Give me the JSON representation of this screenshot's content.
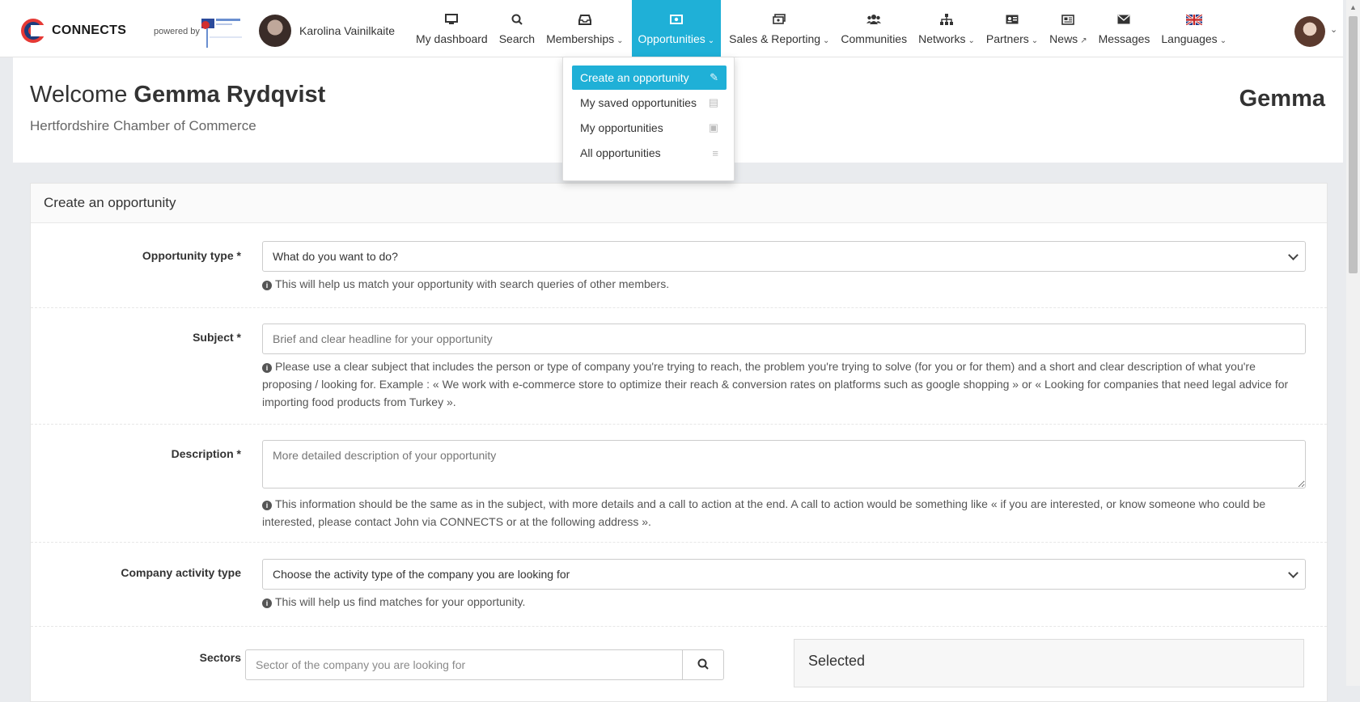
{
  "header": {
    "brand": "CONNECTS",
    "powered_by": "powered by",
    "user_name": "Karolina Vainilkaite",
    "nav": [
      {
        "label": "My dashboard",
        "icon": "monitor-icon",
        "has_chevron": false
      },
      {
        "label": "Search",
        "icon": "search-icon",
        "has_chevron": false
      },
      {
        "label": "Memberships",
        "icon": "inbox-icon",
        "has_chevron": true
      },
      {
        "label": "Opportunities",
        "icon": "money-icon",
        "has_chevron": true,
        "active": true
      },
      {
        "label": "Sales & Reporting",
        "icon": "money-stack-icon",
        "has_chevron": true
      },
      {
        "label": "Communities",
        "icon": "users-icon",
        "has_chevron": false
      },
      {
        "label": "Networks",
        "icon": "sitemap-icon",
        "has_chevron": true
      },
      {
        "label": "Partners",
        "icon": "id-card-icon",
        "has_chevron": true
      },
      {
        "label": "News",
        "icon": "newspaper-icon",
        "has_chevron": false,
        "external": true
      },
      {
        "label": "Messages",
        "icon": "envelope-icon",
        "has_chevron": false
      },
      {
        "label": "Languages",
        "icon": "uk-flag-icon",
        "has_chevron": true
      }
    ],
    "accent_color": "#1fb0d7"
  },
  "dropdown": {
    "items": [
      {
        "label": "Create an opportunity",
        "icon": "edit-icon",
        "active": true
      },
      {
        "label": "My saved opportunities",
        "icon": "save-icon"
      },
      {
        "label": "My opportunities",
        "icon": "money-icon"
      },
      {
        "label": "All opportunities",
        "icon": "list-icon"
      }
    ]
  },
  "welcome": {
    "prefix": "Welcome",
    "name": "Gemma Rydqvist",
    "organisation": "Hertfordshire Chamber of Commerce",
    "right_name": "Gemma"
  },
  "form": {
    "title": "Create an opportunity",
    "opportunity_type": {
      "label": "Opportunity type *",
      "value": "What do you want to do?",
      "help": "This will help us match your opportunity with search queries of other members."
    },
    "subject": {
      "label": "Subject *",
      "placeholder": "Brief and clear headline for your opportunity",
      "help": "Please use a clear subject that includes the person or type of company you're trying to reach, the problem you're trying to solve (for you or for them) and a short and clear description of what you're proposing / looking for. Example : « We work with e-commerce store to optimize their reach & conversion rates on platforms such as google shopping » or « Looking for companies that need legal advice for importing food products from Turkey »."
    },
    "description": {
      "label": "Description *",
      "placeholder": "More detailed description of your opportunity",
      "help": "This information should be the same as in the subject, with more details and a call to action at the end. A call to action would be something like « if you are interested, or know someone who could be interested, please contact John via CONNECTS or at the following address »."
    },
    "company_activity": {
      "label": "Company activity type",
      "value": "Choose the activity type of the company you are looking for",
      "help": "This will help us find matches for your opportunity."
    },
    "sectors": {
      "label": "Sectors",
      "placeholder": "Sector of the company you are looking for",
      "selected_title": "Selected"
    }
  }
}
